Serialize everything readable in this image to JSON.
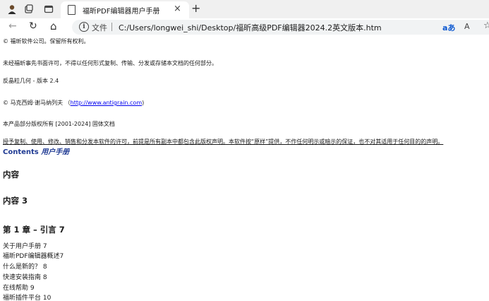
{
  "tab": {
    "title": "福昕PDF编辑器用户手册",
    "close": "×",
    "new_tab": "+"
  },
  "toolbar": {
    "back": "←",
    "reload": "↻",
    "home": "⌂"
  },
  "address": {
    "info": "i",
    "scheme_label": "文件",
    "url": "C:/Users/longwei_shi/Desktop/福昕高级PDF编辑器2024.2英文版本.htm",
    "read_aloud": "aあ",
    "text_size": "A",
    "favorite": "☆"
  },
  "document": {
    "copyright_line": "© 福昕软件公司。保留所有权利。",
    "no_copy_notice": "未经福昕事先书面许可，不得以任何形式复制、传输、分发或存储本文档的任何部分。",
    "version": "反晶粒几何 - 版本 2.4",
    "agg_copyright_prefix": "© 马克西姆·谢马纳列夫 （",
    "agg_link": "http://www.antigrain.com",
    "agg_copyright_suffix": ")",
    "partial_copyright": "本产品部分版权所有 [2001-2024] 固体文档",
    "license_text": "授予复制、使用、修改、销售和分发本软件的许可，前提是所有副本中都包含此版权声明。本软件按“原样”提供，不作任何明示或暗示的保证，也不对其适用于任何目的的声明。",
    "contents_label": "Contents",
    "contents_label_italic": "用户手册",
    "heading_1": "内容",
    "heading_2": "内容 3",
    "heading_3": "第 1 章 – 引言 7",
    "toc": [
      "关于用户手册 7",
      "福昕PDF编辑器概述7",
      "什么是新的？ 8",
      "快速安装指南 8",
      "在线帮助 9",
      "福昕插件平台 10"
    ]
  }
}
